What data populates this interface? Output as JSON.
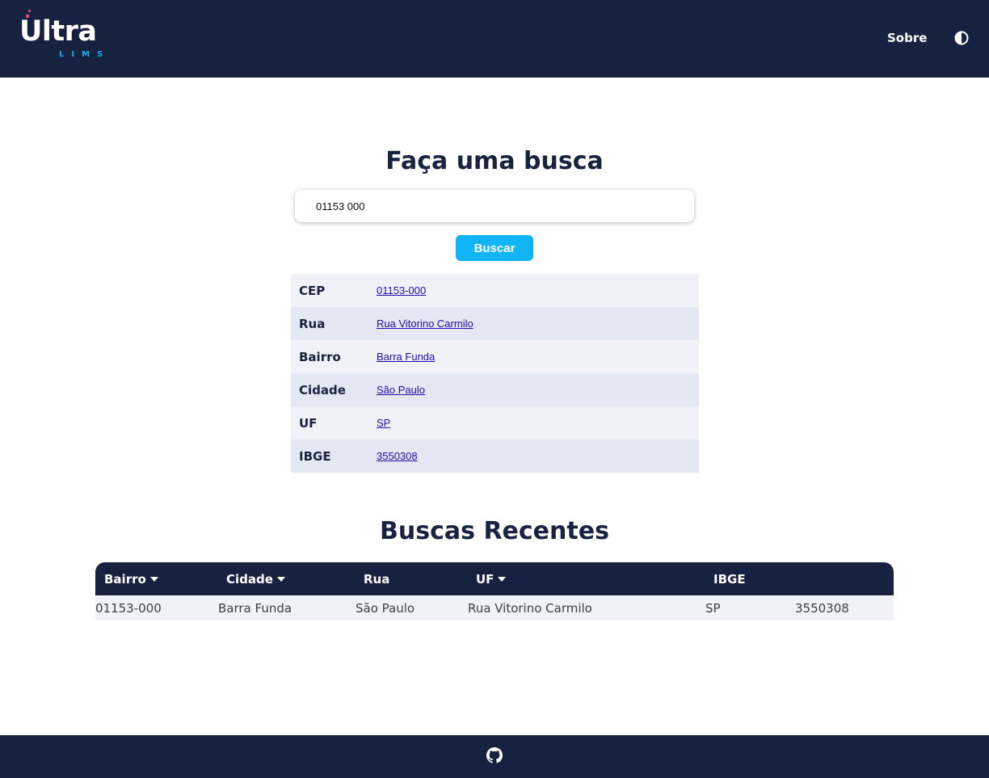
{
  "header": {
    "logo_word": "Ultra",
    "logo_sub": "LIMS",
    "nav_about": "Sobre",
    "theme_icon": "contrast-icon"
  },
  "search": {
    "title": "Faça uma busca",
    "input_value": "01153 000",
    "button_label": "Buscar"
  },
  "result": {
    "rows": [
      {
        "label": "CEP",
        "value": "01153-000"
      },
      {
        "label": "Rua",
        "value": "Rua Vitorino Carmilo"
      },
      {
        "label": "Bairro",
        "value": "Barra Funda"
      },
      {
        "label": "Cidade",
        "value": "São Paulo"
      },
      {
        "label": "UF",
        "value": "SP"
      },
      {
        "label": "IBGE",
        "value": "3550308"
      }
    ]
  },
  "recent": {
    "title": "Buscas Recentes",
    "headers": [
      "Bairro",
      "Cidade",
      "Rua",
      "UF",
      "IBGE"
    ],
    "rows": [
      [
        "01153-000",
        "Barra Funda",
        "São Paulo",
        "Rua Vitorino Carmilo",
        "SP",
        "3550308"
      ]
    ]
  },
  "footer": {
    "icon": "github-icon"
  },
  "colors": {
    "navy": "#172240",
    "accent": "#12b5f3",
    "link": "#1a0dab",
    "logo_dots": "#e84c6a"
  }
}
